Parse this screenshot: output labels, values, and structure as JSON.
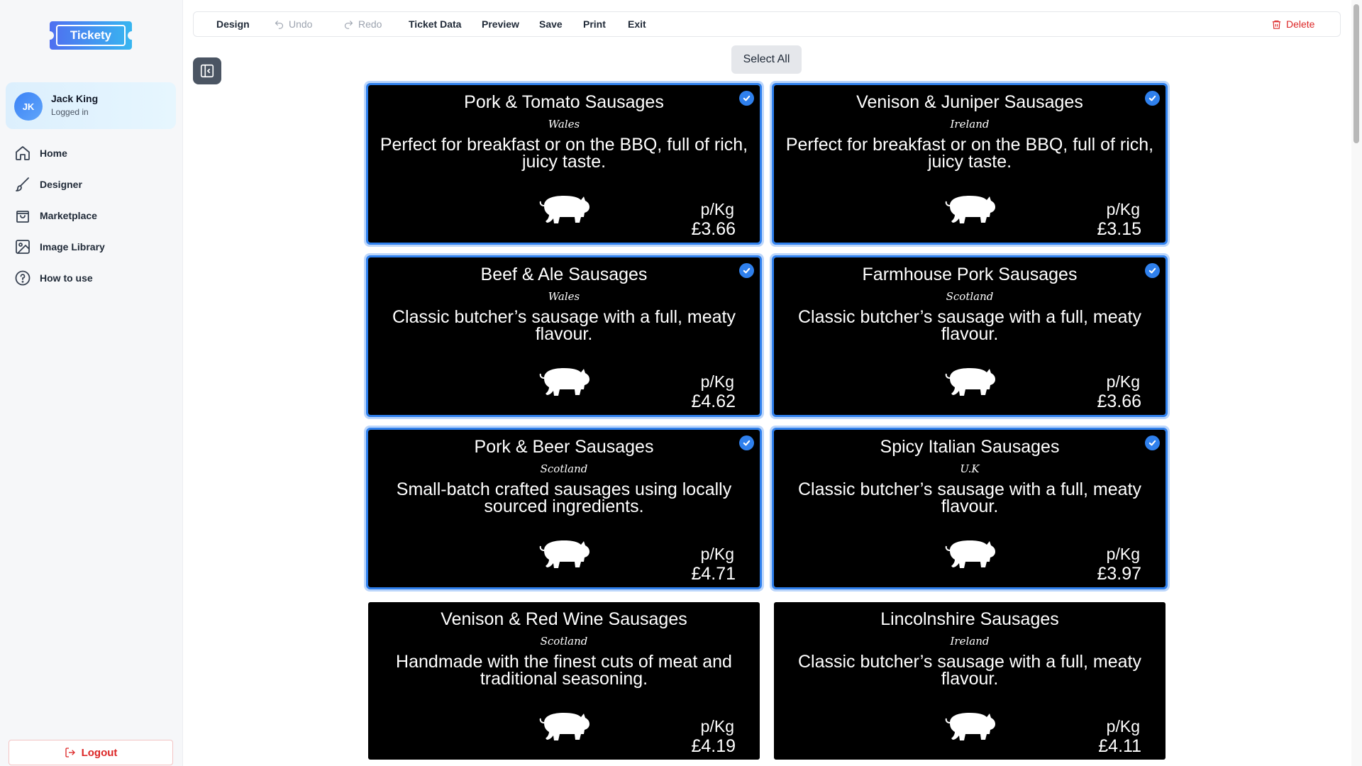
{
  "app": {
    "logo_text": "Tickety"
  },
  "user": {
    "initials": "JK",
    "name": "Jack King",
    "status": "Logged in"
  },
  "nav": [
    {
      "label": "Home",
      "icon": "home-icon"
    },
    {
      "label": "Designer",
      "icon": "brush-icon"
    },
    {
      "label": "Marketplace",
      "icon": "shopping-bag-icon"
    },
    {
      "label": "Image Library",
      "icon": "image-icon"
    },
    {
      "label": "How to use",
      "icon": "help-circle-icon"
    }
  ],
  "logout_label": "Logout",
  "toolbar": {
    "design": "Design",
    "undo": "Undo",
    "redo": "Redo",
    "ticket_data": "Ticket Data",
    "preview": "Preview",
    "save": "Save",
    "print": "Print",
    "exit": "Exit",
    "delete": "Delete"
  },
  "select_all_label": "Select All",
  "colors": {
    "accent": "#2f80ed",
    "danger": "#dc2626",
    "ticket_bg": "#000000"
  },
  "tickets": [
    {
      "title": "Pork & Tomato Sausages",
      "origin": "Wales",
      "desc": "Perfect for breakfast or on the BBQ, full of rich, juicy taste.",
      "unit": "p/Kg",
      "price": "£3.66",
      "selected": true
    },
    {
      "title": "Venison & Juniper Sausages",
      "origin": "Ireland",
      "desc": "Perfect for breakfast or on the BBQ, full of rich, juicy taste.",
      "unit": "p/Kg",
      "price": "£3.15",
      "selected": true
    },
    {
      "title": "Beef & Ale Sausages",
      "origin": "Wales",
      "desc": "Classic butcher’s sausage with a full, meaty flavour.",
      "unit": "p/Kg",
      "price": "£4.62",
      "selected": true
    },
    {
      "title": "Farmhouse Pork Sausages",
      "origin": "Scotland",
      "desc": "Classic butcher’s sausage with a full, meaty flavour.",
      "unit": "p/Kg",
      "price": "£3.66",
      "selected": true
    },
    {
      "title": "Pork & Beer Sausages",
      "origin": "Scotland",
      "desc": "Small-batch crafted sausages using locally sourced ingredients.",
      "unit": "p/Kg",
      "price": "£4.71",
      "selected": true
    },
    {
      "title": "Spicy Italian Sausages",
      "origin": "U.K",
      "desc": "Classic butcher’s sausage with a full, meaty flavour.",
      "unit": "p/Kg",
      "price": "£3.97",
      "selected": true
    },
    {
      "title": "Venison & Red Wine Sausages",
      "origin": "Scotland",
      "desc": "Handmade with the finest cuts of meat and traditional seasoning.",
      "unit": "p/Kg",
      "price": "£4.19",
      "selected": false
    },
    {
      "title": "Lincolnshire Sausages",
      "origin": "Ireland",
      "desc": "Classic butcher’s sausage with a full, meaty flavour.",
      "unit": "p/Kg",
      "price": "£4.11",
      "selected": false
    }
  ]
}
